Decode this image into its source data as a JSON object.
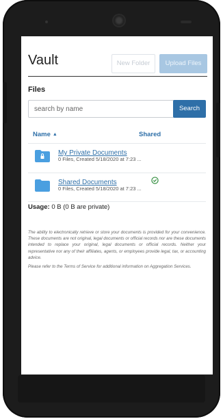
{
  "app": {
    "title": "Vault"
  },
  "toolbar": {
    "new_folder_label": "New Folder",
    "upload_label": "Upload Files"
  },
  "files": {
    "section_title": "Files",
    "search": {
      "placeholder": "search by name",
      "button_label": "Search"
    },
    "columns": {
      "name": "Name",
      "name_sort_icon": "sort-ascending-icon",
      "shared": "Shared"
    },
    "rows": [
      {
        "name": "My Private Documents",
        "meta": "0 Files, Created 5/18/2020 at 7:23 ...",
        "icon": "locked-folder-icon",
        "shared": false
      },
      {
        "name": "Shared Documents",
        "meta": "0 Files, Created 5/18/2020 at 7:23 ...",
        "icon": "folder-icon",
        "shared": true,
        "shared_icon": "check-circle-icon"
      }
    ],
    "usage": {
      "label": "Usage:",
      "value": "0 B (0 B are private)"
    }
  },
  "disclaimer": {
    "p1": "The ability to electronically retrieve or store your documents is provided for your convenience. These documents are not original, legal documents or official records nor are these documents intended to replace your original, legal documents or official records. Neither your representative nor any of their affiliates, agents, or employees provide legal, tax, or accounting advice.",
    "p2": "Please refer to the Terms of Service for additional information on Aggregation Services."
  },
  "colors": {
    "accent": "#2e6fa8",
    "folder": "#4a9fe0",
    "shared_check": "#2e8b3a",
    "upload_disabled": "#a8c7e2"
  }
}
